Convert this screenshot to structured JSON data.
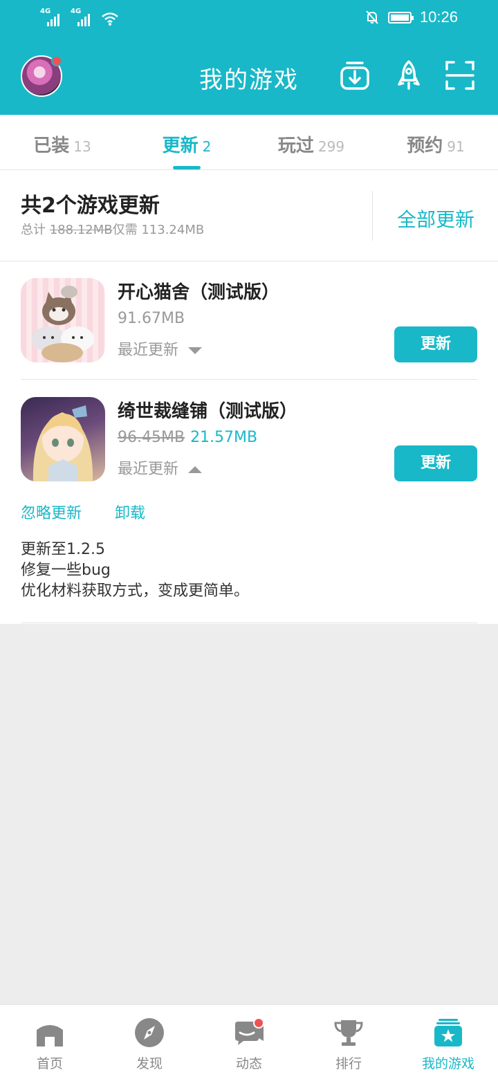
{
  "colors": {
    "accent": "#18b8c8",
    "badge": "#f05252"
  },
  "status": {
    "network1": "4G",
    "network2": "4G",
    "time": "10:26"
  },
  "header": {
    "title": "我的游戏"
  },
  "tabs": [
    {
      "label": "已装",
      "count": "13"
    },
    {
      "label": "更新",
      "count": "2"
    },
    {
      "label": "玩过",
      "count": "299"
    },
    {
      "label": "预约",
      "count": "91"
    }
  ],
  "summary": {
    "title": "共2个游戏更新",
    "total_prefix": "总计",
    "total_size": "188.12MB",
    "need_prefix": "仅需",
    "need_size": "113.24MB",
    "update_all": "全部更新"
  },
  "games": [
    {
      "name": "开心猫舍（测试版）",
      "size": "91.67MB",
      "recent": "最近更新",
      "button": "更新"
    },
    {
      "name": "绮世裁缝铺（测试版）",
      "old_size": "96.45MB",
      "new_size": "21.57MB",
      "recent": "最近更新",
      "button": "更新",
      "actions": [
        "忽略更新",
        "卸载"
      ],
      "notes": [
        "更新至1.2.5",
        "修复一些bug",
        "优化材料获取方式，变成更简单。"
      ]
    }
  ],
  "nav": [
    {
      "label": "首页",
      "icon": "home-icon"
    },
    {
      "label": "发现",
      "icon": "compass-icon"
    },
    {
      "label": "动态",
      "icon": "chat-icon"
    },
    {
      "label": "排行",
      "icon": "trophy-icon"
    },
    {
      "label": "我的游戏",
      "icon": "my-games-icon"
    }
  ]
}
